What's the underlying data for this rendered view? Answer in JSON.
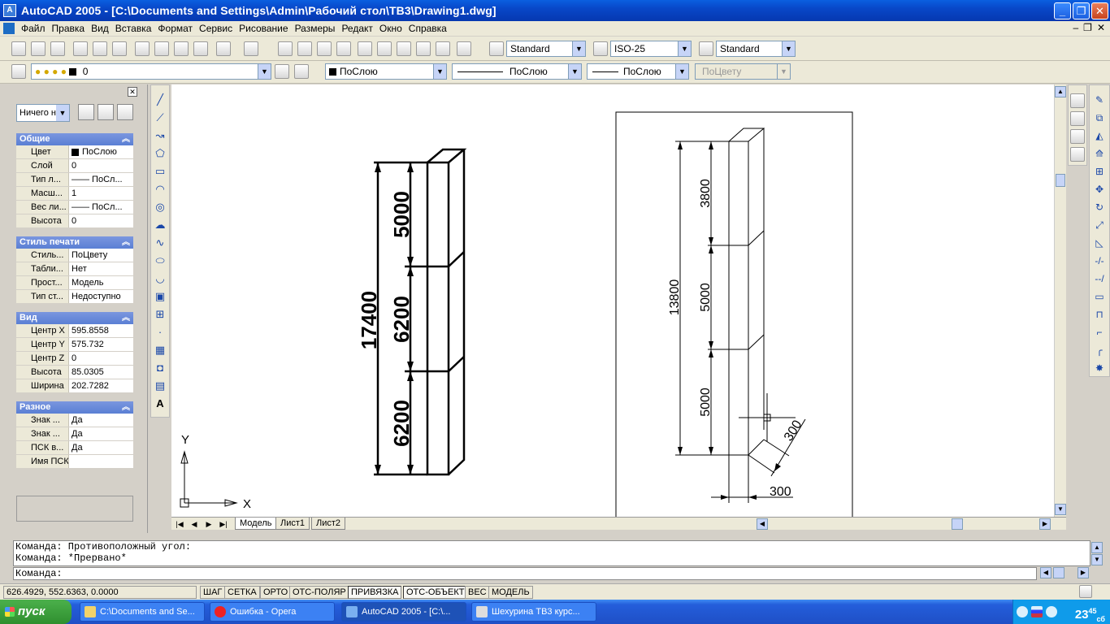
{
  "window": {
    "title": "AutoCAD 2005 - [C:\\Documents and Settings\\Admin\\Рабочий стол\\ТВ3\\Drawing1.dwg]",
    "app_icon": "autocad-icon"
  },
  "menu": [
    "Файл",
    "Правка",
    "Вид",
    "Вставка",
    "Формат",
    "Сервис",
    "Рисование",
    "Размеры",
    "Редакт",
    "Окно",
    "Справка"
  ],
  "toolbar": {
    "text_style": "Standard",
    "dim_style": "ISO-25",
    "table_style": "Standard",
    "layer": "0",
    "color": "ПоСлою",
    "linetype": "ПоСлою",
    "lineweight": "ПоСлою",
    "plotstyle": "ПоЦвету"
  },
  "properties": {
    "filter": "Ничего н",
    "sections": [
      {
        "title": "Общие",
        "rows": [
          {
            "k": "Цвет",
            "v": "ПоСлою"
          },
          {
            "k": "Слой",
            "v": "0"
          },
          {
            "k": "Тип л...",
            "v": "—— ПоСл..."
          },
          {
            "k": "Масш...",
            "v": "1"
          },
          {
            "k": "Вес ли...",
            "v": "—— ПоСл..."
          },
          {
            "k": "Высота",
            "v": "0"
          }
        ]
      },
      {
        "title": "Стиль печати",
        "rows": [
          {
            "k": "Стиль...",
            "v": "ПоЦвету"
          },
          {
            "k": "Табли...",
            "v": "Нет"
          },
          {
            "k": "Прост...",
            "v": "Модель"
          },
          {
            "k": "Тип ст...",
            "v": "Недоступно"
          }
        ]
      },
      {
        "title": "Вид",
        "rows": [
          {
            "k": "Центр X",
            "v": "595.8558"
          },
          {
            "k": "Центр Y",
            "v": "575.732"
          },
          {
            "k": "Центр Z",
            "v": "0"
          },
          {
            "k": "Высота",
            "v": "85.0305"
          },
          {
            "k": "Ширина",
            "v": "202.7282"
          }
        ]
      },
      {
        "title": "Разное",
        "rows": [
          {
            "k": "Знак ...",
            "v": "Да"
          },
          {
            "k": "Знак ...",
            "v": "Да"
          },
          {
            "k": "ПСК в...",
            "v": "Да"
          },
          {
            "k": "Имя ПСК",
            "v": ""
          }
        ]
      }
    ]
  },
  "drawing": {
    "left_dims": [
      "17400",
      "5000",
      "6200",
      "6200"
    ],
    "right_dims": [
      "13800",
      "3800",
      "5000",
      "5000"
    ],
    "small_dims": [
      "300",
      "300"
    ],
    "ucs_x": "X",
    "ucs_y": "Y"
  },
  "tabs": [
    "Модель",
    "Лист1",
    "Лист2"
  ],
  "command": {
    "line1": "Команда: Противоположный угол:",
    "line2": "Команда: *Прервано*",
    "prompt": "Команда:"
  },
  "status": {
    "coords": "626.4929, 552.6363, 0.0000",
    "buttons": [
      "ШАГ",
      "СЕТКА",
      "ОРТО",
      "ОТС-ПОЛЯР",
      "ПРИВЯЗКА",
      "ОТС-ОБЪЕКТ",
      "ВЕС",
      "МОДЕЛЬ"
    ]
  },
  "taskbar": {
    "start": "пуск",
    "tasks": [
      "C:\\Documents and Se...",
      "Ошибка - Opera",
      "AutoCAD 2005 - [C:\\...",
      "Шехурина ТВ3 курс..."
    ],
    "clock": "23",
    "clock_min": "45",
    "clock_day": "сб"
  }
}
